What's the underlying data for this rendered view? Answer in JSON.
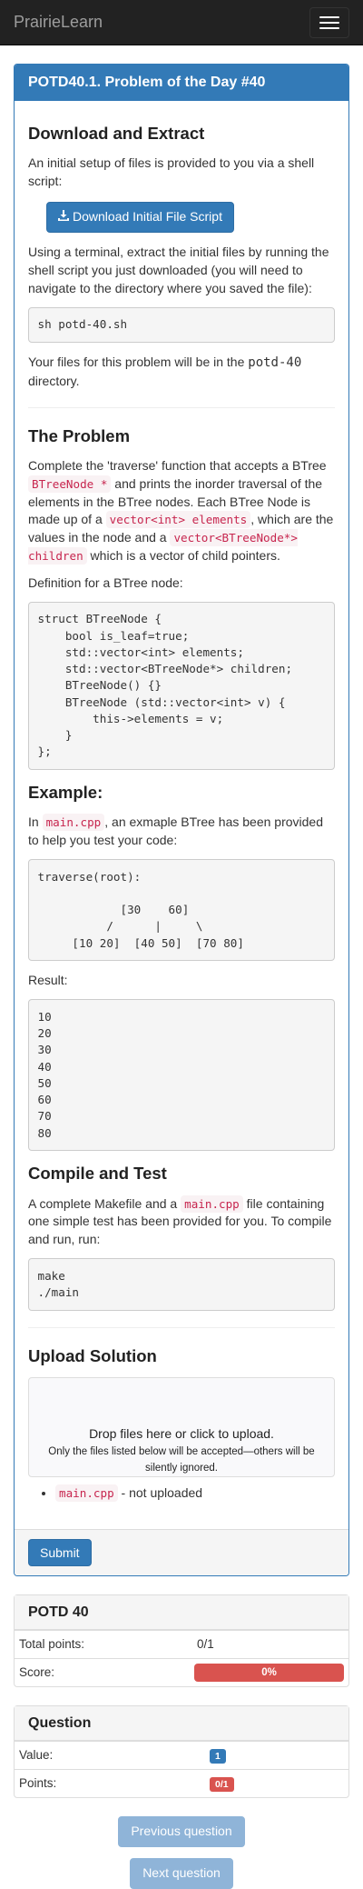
{
  "navbar": {
    "brand": "PrairieLearn"
  },
  "question": {
    "title": "POTD40.1. Problem of the Day #40",
    "download": {
      "heading": "Download and Extract",
      "intro": "An initial setup of files is provided to you via a shell script:",
      "button_label": "Download Initial File Script",
      "instructions": "Using a terminal, extract the initial files by running the shell script you just downloaded (you will need to navigate to the directory where you saved the file):",
      "command": "sh potd-40.sh",
      "dir_pre": "Your files for this problem will be in the ",
      "dir_name": "potd-40",
      "dir_post": " directory."
    },
    "problem": {
      "heading": "The Problem",
      "t1": "Complete the 'traverse' function that accepts a BTree ",
      "c1": "BTreeNode *",
      "t2": " and prints the inorder traversal of the elements in the BTree nodes. Each BTree Node is made up of a ",
      "c2": "vector<int> elements",
      "t3": ", which are the values in the node and a ",
      "c3": "vector<BTreeNode*> children",
      "t4": " which is a vector of child pointers.",
      "def_label": "Definition for a BTree node:",
      "def_code": "struct BTreeNode {\n    bool is_leaf=true;\n    std::vector<int> elements;\n    std::vector<BTreeNode*> children;\n    BTreeNode() {}\n    BTreeNode (std::vector<int> v) {\n        this->elements = v;\n    }\n};"
    },
    "example": {
      "heading": "Example:",
      "t1": "In ",
      "c1": "main.cpp",
      "t2": ", an exmaple BTree has been provided to help you test your code:",
      "code": "traverse(root):\n\n            [30    60]\n          /      |     \\\n     [10 20]  [40 50]  [70 80]",
      "result_label": "Result:",
      "result": "10\n20\n30\n40\n50\n60\n70\n80"
    },
    "compile": {
      "heading": "Compile and Test",
      "t1": "A complete Makefile and a ",
      "c1": "main.cpp",
      "t2": " file containing one simple test has been provided for you. To compile and run, run:",
      "code": "make\n./main"
    },
    "upload": {
      "heading": "Upload Solution",
      "drop_main": "Drop files here or click to upload.",
      "drop_sub": "Only the files listed below will be accepted—others will be silently ignored.",
      "file_name": "main.cpp",
      "file_status": " - not uploaded"
    },
    "submit_label": "Submit"
  },
  "score_panel": {
    "title": "POTD 40",
    "total_points_label": "Total points:",
    "total_points_value": "0/1",
    "score_label": "Score:",
    "score_value": "0%",
    "score_fraction": 0
  },
  "question_panel": {
    "title": "Question",
    "value_label": "Value:",
    "value": "1",
    "points_label": "Points:",
    "points": "0/1"
  },
  "nav": {
    "previous_label": "Previous question",
    "next_label": "Next question"
  },
  "colors": {
    "primary": "#337ab7",
    "danger": "#d9534f",
    "code_text": "#c7254e"
  }
}
